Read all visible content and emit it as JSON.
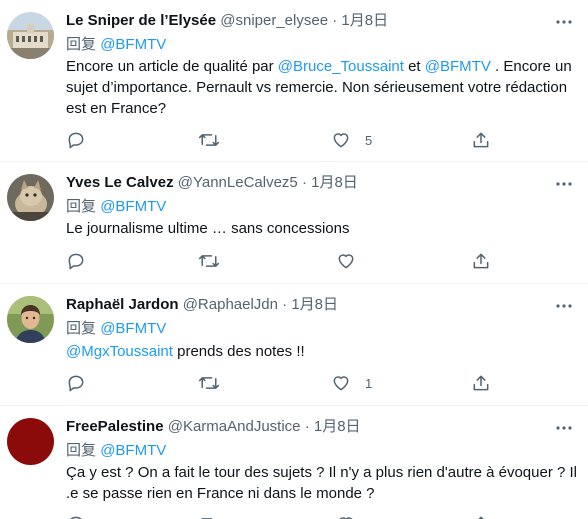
{
  "tweets": [
    {
      "name": "Le Sniper de l’Elysée",
      "handle": "@sniper_elysee",
      "dot": "·",
      "date": "1月8日",
      "reply_prefix": "回复",
      "reply_to": "@BFMTV",
      "body": [
        {
          "text": "Encore un article de qualité par ",
          "mention": false
        },
        {
          "text": "@Bruce_Toussaint",
          "mention": true
        },
        {
          "text": " et ",
          "mention": false
        },
        {
          "text": "@BFMTV",
          "mention": true
        },
        {
          "text": " . Encore un sujet d’importance. Pernault vs remercie. Non sérieusement votre rédaction est en France?",
          "mention": false
        }
      ],
      "like_count": "5",
      "avatar": "building-photo"
    },
    {
      "name": "Yves Le Calvez",
      "handle": "@YannLeCalvez5",
      "dot": "·",
      "date": "1月8日",
      "reply_prefix": "回复",
      "reply_to": "@BFMTV",
      "body": [
        {
          "text": "Le journalisme ultime … sans concessions",
          "mention": false
        }
      ],
      "like_count": "",
      "avatar": "cat-photo"
    },
    {
      "name": "Raphaël Jardon",
      "handle": "@RaphaelJdn",
      "dot": "·",
      "date": "1月8日",
      "reply_prefix": "回复",
      "reply_to": "@BFMTV",
      "body": [
        {
          "text": "@MgxToussaint",
          "mention": true
        },
        {
          "text": " prends des notes !!",
          "mention": false
        }
      ],
      "like_count": "1",
      "avatar": "portrait-photo"
    },
    {
      "name": "FreePalestine",
      "handle": "@KarmaAndJustice",
      "dot": "·",
      "date": "1月8日",
      "reply_prefix": "回复",
      "reply_to": "@BFMTV",
      "body": [
        {
          "text": "Ça y est ? On a fait le tour des sujets ? Il n'y a plus rien d'autre à évoquer ? Il .e se passe rien en France ni dans le monde ?",
          "mention": false
        }
      ],
      "like_count": "",
      "avatar": "red-circle"
    }
  ],
  "colors": {
    "text": "#0f1419",
    "secondary": "#536471",
    "accent": "#1d9bf0",
    "divider": "#eff3f4",
    "avatar_red": "#8b0a0a"
  },
  "icons": [
    "more-icon",
    "reply-icon",
    "retweet-icon",
    "like-icon",
    "share-icon"
  ]
}
